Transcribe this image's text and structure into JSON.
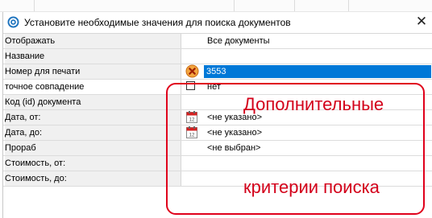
{
  "dialog": {
    "title": "Установите необходимые значения для поиска документов",
    "close_glyph": "✕"
  },
  "rows": [
    {
      "label": "Отображать",
      "value": "Все документы"
    },
    {
      "label": "Название",
      "value": ""
    },
    {
      "label": "Номер для печати",
      "value": "3553",
      "icon": "clear-icon",
      "selected": true
    },
    {
      "label": "точное совпадение",
      "value": "нет",
      "checkbox": false
    },
    {
      "label": "Код (id) документа",
      "value": ""
    },
    {
      "label": "Дата, от:",
      "value": "<не указано>",
      "icon": "calendar-icon"
    },
    {
      "label": "Дата, до:",
      "value": "<не указано>",
      "icon": "calendar-icon"
    },
    {
      "label": "Прораб",
      "value": "<не выбран>"
    },
    {
      "label": "Стоимость, от:",
      "value": ""
    },
    {
      "label": "Стоимость, до:",
      "value": ""
    }
  ],
  "annotation": {
    "line1": "Дополнительные",
    "line2": "критерии поиска"
  },
  "colors": {
    "selection": "#0078d7",
    "annotation": "#e0001b"
  }
}
